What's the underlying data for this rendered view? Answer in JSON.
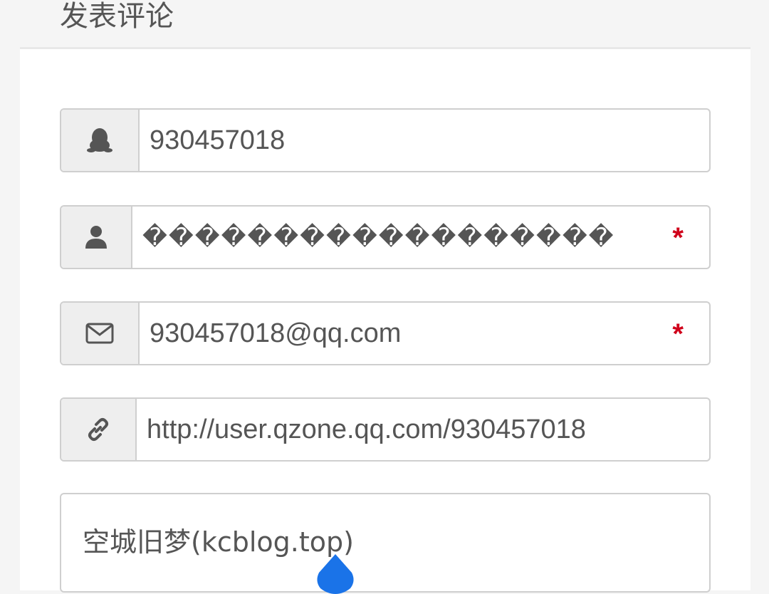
{
  "header": {
    "title": "发表评论"
  },
  "form": {
    "qq": {
      "value": "930457018",
      "icon": "qq-penguin-icon"
    },
    "nickname": {
      "value": "������������������",
      "required_mark": "*",
      "icon": "user-icon"
    },
    "email": {
      "value": "930457018@qq.com",
      "required_mark": "*",
      "icon": "envelope-icon"
    },
    "website": {
      "value": "http://user.qzone.qq.com/930457018",
      "icon": "link-icon"
    },
    "comment": {
      "value": "空城旧梦(kcblog.top)"
    }
  },
  "colors": {
    "required": "#d0021b",
    "cursor": "#1a73e8"
  }
}
